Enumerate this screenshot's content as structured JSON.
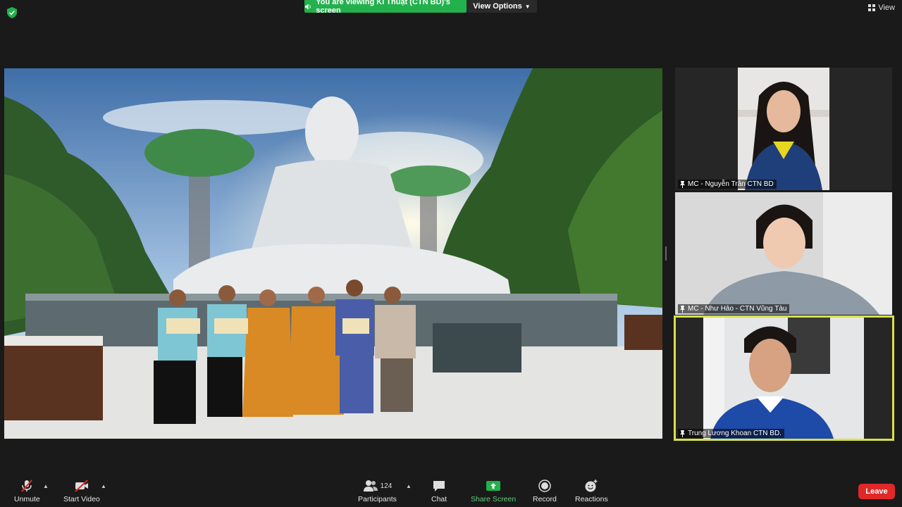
{
  "banner": {
    "viewing_text": "You are viewing Kĩ Thuật (CTN BD)'s screen",
    "view_options_label": "View Options",
    "view_label": "View"
  },
  "colors": {
    "banner_green": "#22b14c",
    "leave_red": "#e02828",
    "active_speaker": "#d8e04a",
    "share_screen_green": "#22b14c"
  },
  "participants": [
    {
      "name": "MC - Nguyễn Trân CTN BD",
      "pinned": true
    },
    {
      "name": "MC - Như Hảo - CTN Vũng Tàu",
      "pinned": true
    },
    {
      "name": "Trung Lương Khoan CTN BD.",
      "pinned": true,
      "active_speaker": true
    }
  ],
  "toolbar": {
    "unmute_label": "Unmute",
    "start_video_label": "Start Video",
    "participants_label": "Participants",
    "participants_count": "124",
    "chat_label": "Chat",
    "share_screen_label": "Share Screen",
    "record_label": "Record",
    "reactions_label": "Reactions",
    "leave_label": "Leave"
  },
  "icons": {
    "security": "shield-icon",
    "mic": "mic-muted-icon",
    "video": "video-off-icon",
    "participants": "people-icon",
    "chat": "chat-bubble-icon",
    "share": "share-screen-icon",
    "record": "record-icon",
    "reactions": "emoji-icon",
    "pin": "pin-icon"
  }
}
